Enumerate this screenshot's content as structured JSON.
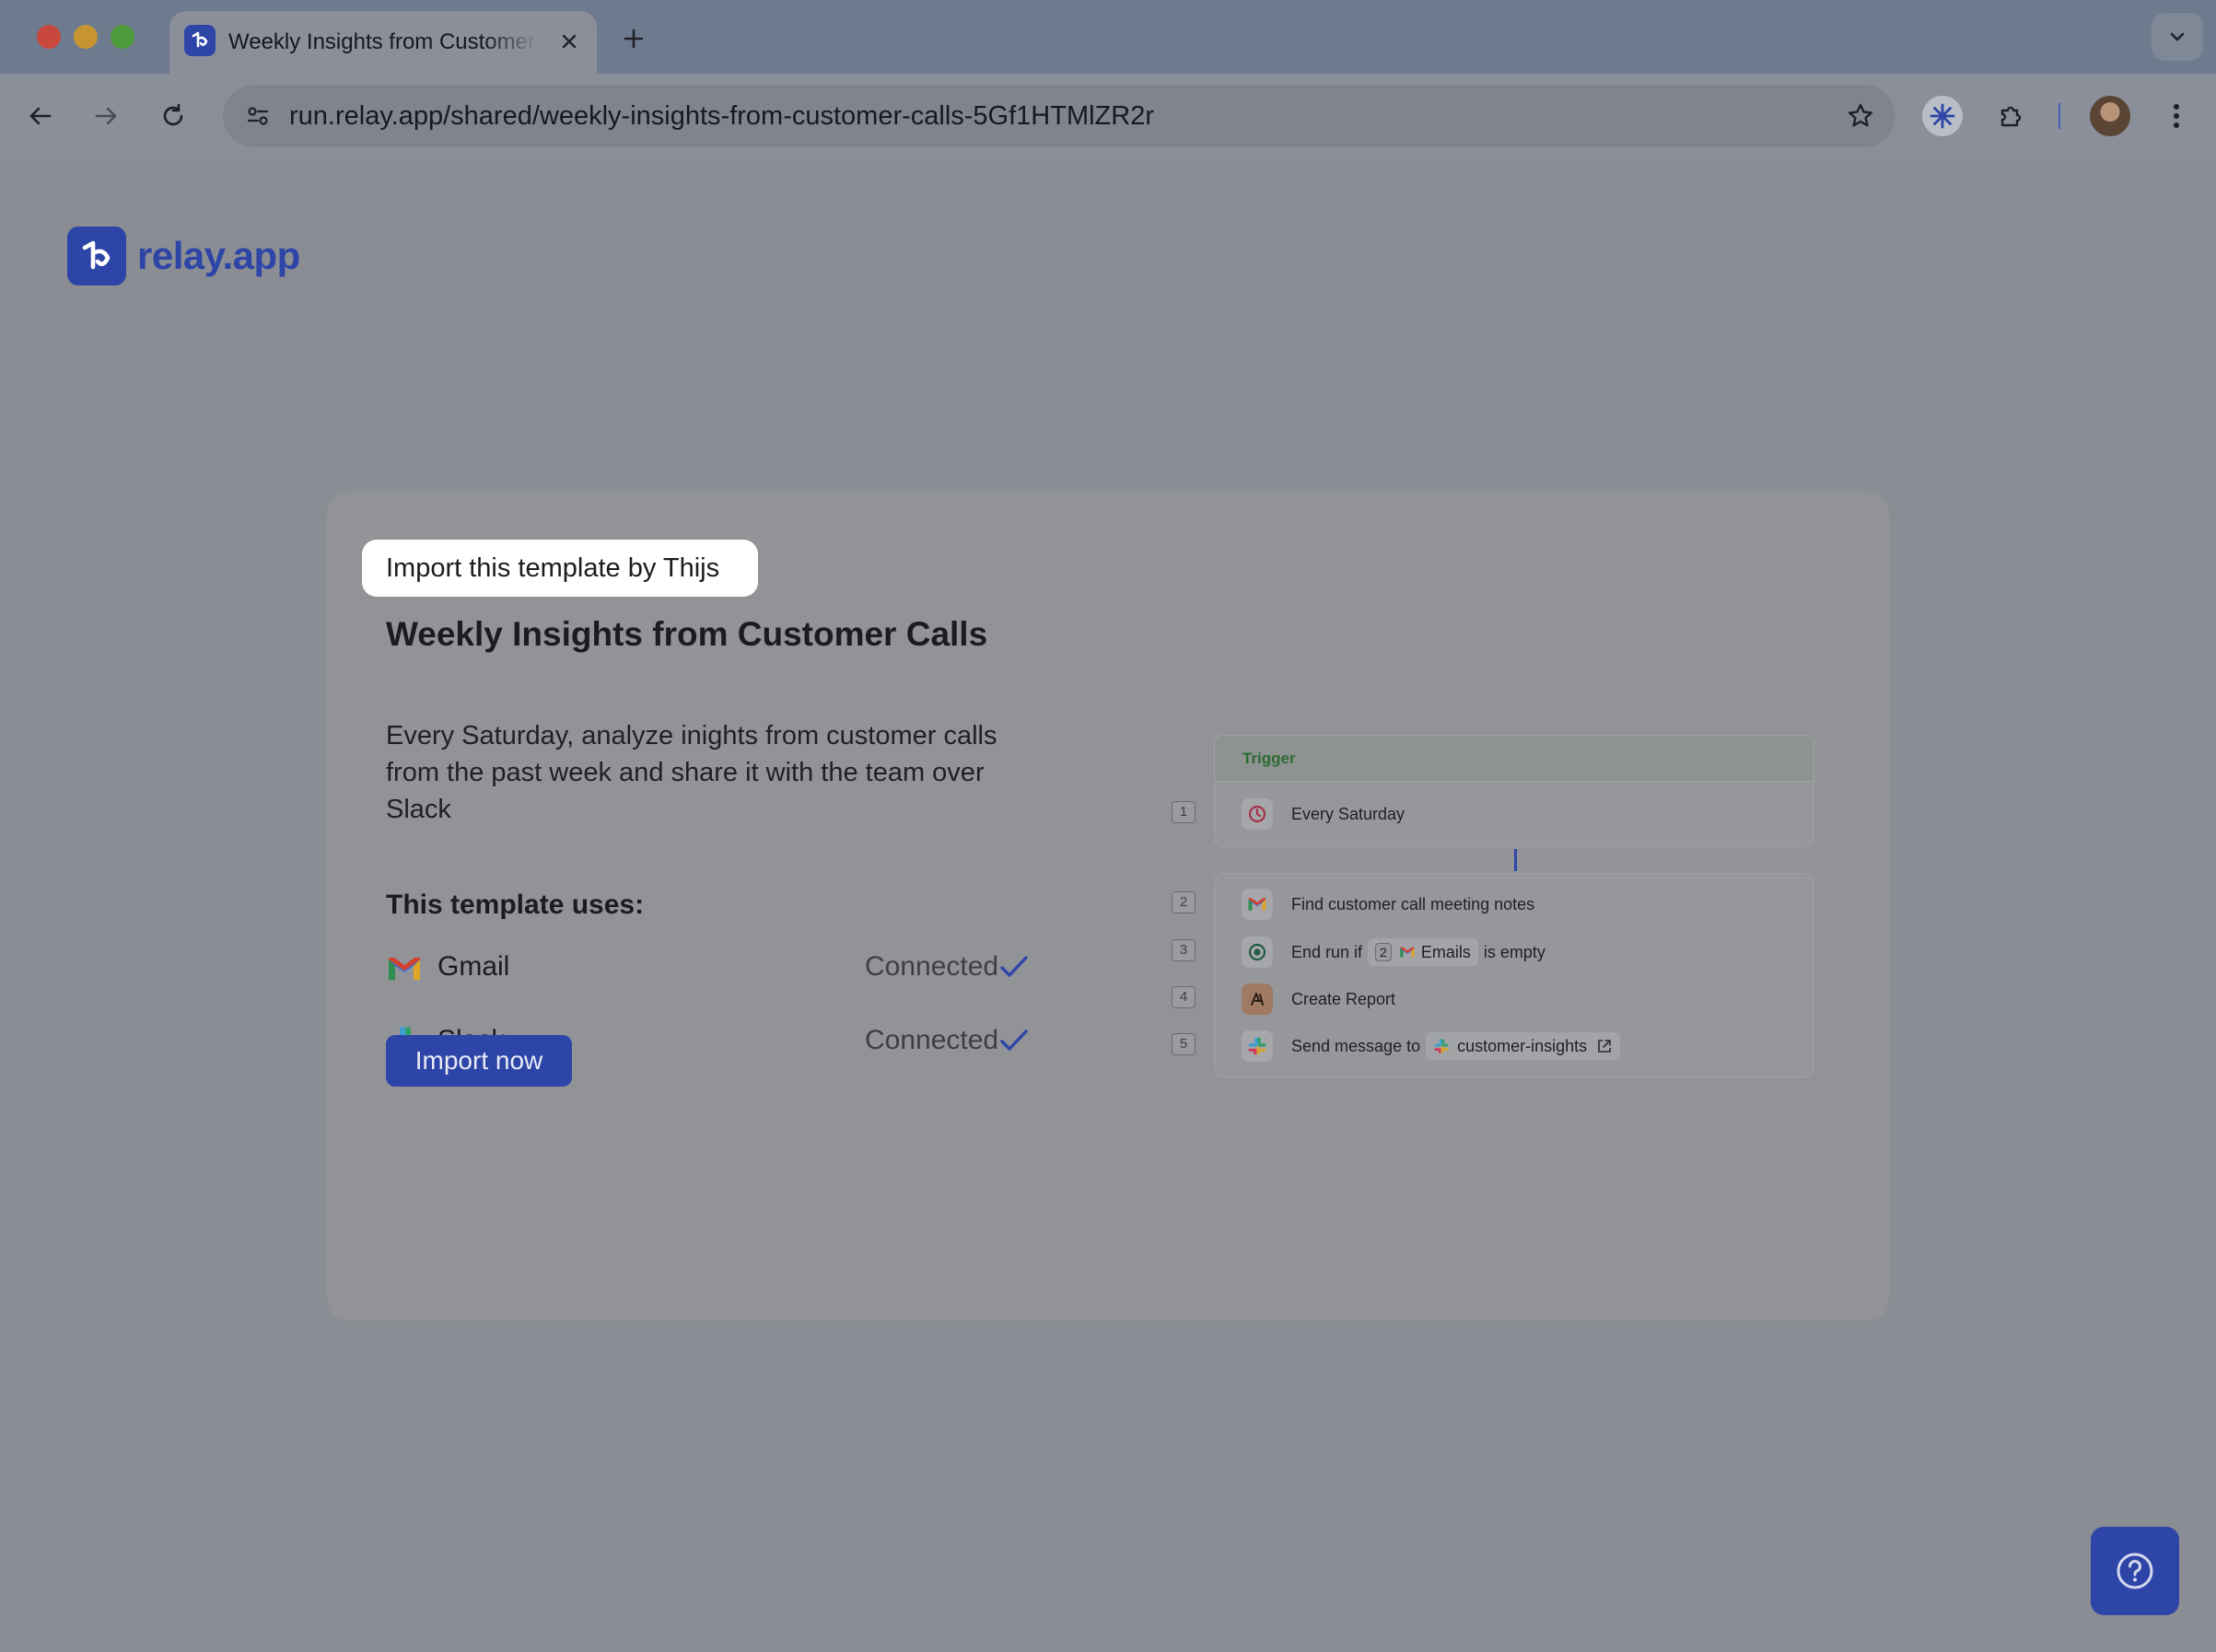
{
  "window": {
    "tab_title": "Weekly Insights from Customer Calls",
    "url": "run.relay.app/shared/weekly-insights-from-customer-calls-5Gf1HTMlZR2r"
  },
  "brand": {
    "name": "relay.app",
    "color": "#2e45a8"
  },
  "card": {
    "badge": "Import this template by Thijs",
    "title": "Weekly Insights from Customer Calls",
    "description": "Every Saturday, analyze inights from customer calls from the past week and share it with the team over Slack",
    "uses_title": "This template uses:",
    "apps": [
      {
        "name": "Gmail",
        "status": "Connected",
        "icon": "gmail-icon"
      },
      {
        "name": "Slack",
        "status": "Connected",
        "icon": "slack-icon"
      }
    ],
    "import_label": "Import now"
  },
  "workflow": {
    "trigger_label": "Trigger",
    "steps": [
      {
        "num": "1",
        "icon": "clock-icon",
        "text": "Every Saturday"
      },
      {
        "num": "2",
        "icon": "gmail-icon",
        "text": "Find customer call meeting notes"
      },
      {
        "num": "3",
        "icon": "stop-icon",
        "prefix": "End run if",
        "ref_num": "2",
        "ref_label": "Emails",
        "suffix": "is empty"
      },
      {
        "num": "4",
        "icon": "ai-icon",
        "text": "Create Report"
      },
      {
        "num": "5",
        "icon": "slack-icon",
        "prefix": "Send message to",
        "channel": "customer-insights"
      }
    ]
  }
}
